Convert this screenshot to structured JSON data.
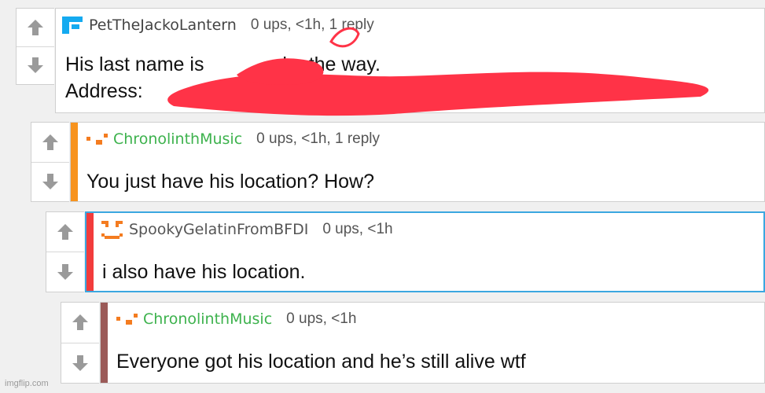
{
  "comments": [
    {
      "username": "PetTheJackoLantern",
      "meta": "0 ups, <1h, 1 reply",
      "text_lines": [
        "His last name is",
        "Address:"
      ],
      "text_tail": "by the way.",
      "avatar": "pixel-tetris-avatar-blue",
      "accent_color": null
    },
    {
      "username": "ChronolinthMusic",
      "meta": "0 ups, <1h, 1 reply",
      "text_lines": [
        "You just have his location? How?"
      ],
      "avatar": "pixel-dots-avatar-orange",
      "accent_color": "#f7931e"
    },
    {
      "username": "SpookyGelatinFromBFDI",
      "meta": "0 ups, <1h",
      "text_lines": [
        "i also have his location."
      ],
      "avatar": "pixel-smiley-avatar-orange",
      "accent_color": "#f23c3c"
    },
    {
      "username": "ChronolinthMusic",
      "meta": "0 ups, <1h",
      "text_lines": [
        "Everyone got his location and he’s still alive wtf"
      ],
      "avatar": "pixel-dots-avatar-orange",
      "accent_color": "#9b5a58"
    }
  ],
  "colors": {
    "username": "#3db24d",
    "redaction": "#ff3347",
    "selected_border": "#3ba7e0"
  },
  "watermark": "imgflip.com"
}
